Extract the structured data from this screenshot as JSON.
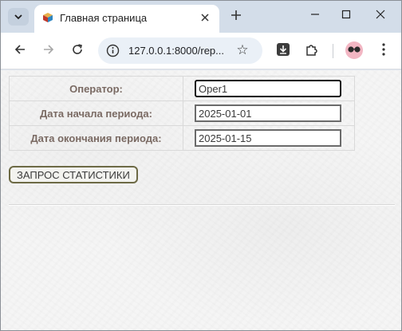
{
  "browser": {
    "tab": {
      "title": "Главная страница"
    },
    "address_bar": {
      "url": "127.0.0.1:8000/rep..."
    }
  },
  "form": {
    "operator": {
      "label": "Оператор:",
      "value": "Oper1"
    },
    "start_date": {
      "label": "Дата начала периода:",
      "value": "2025-01-01"
    },
    "end_date": {
      "label": "Дата окончания периода:",
      "value": "2025-01-15"
    },
    "submit_label": "ЗАПРОС СТАТИСТИКИ"
  }
}
